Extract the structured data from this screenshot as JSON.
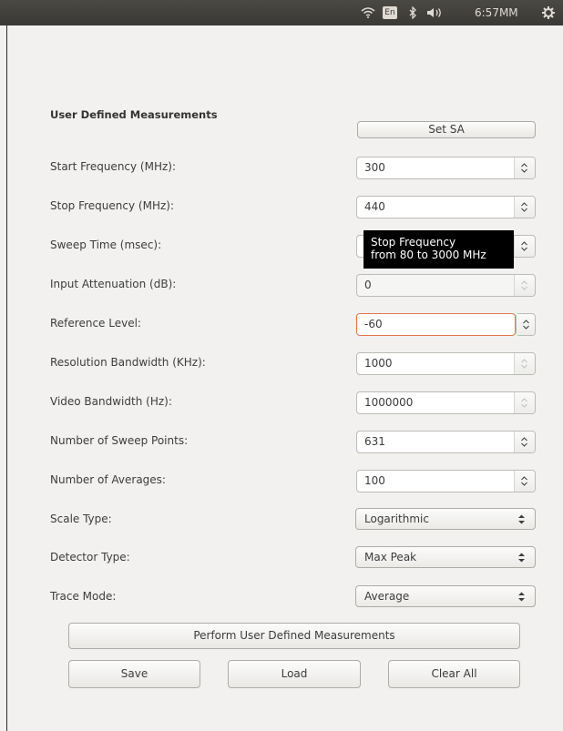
{
  "topbar": {
    "clock": "6:57MM",
    "keyboard_layout": "En"
  },
  "panel": {
    "heading": "User Defined Measurements",
    "set_sa_button": "Set SA",
    "fields": [
      {
        "label": "Start Frequency (MHz):",
        "value": "300"
      },
      {
        "label": "Stop Frequency (MHz):",
        "value": "440"
      },
      {
        "label": "Sweep Time (msec):",
        "value": ""
      },
      {
        "label": "Input Attenuation (dB):",
        "value": "0"
      },
      {
        "label": "Reference Level:",
        "value": "-60"
      },
      {
        "label": "Resolution Bandwidth (KHz):",
        "value": "1000"
      },
      {
        "label": "Video Bandwidth (Hz):",
        "value": "1000000"
      },
      {
        "label": "Number of Sweep Points:",
        "value": "631"
      },
      {
        "label": "Number of Averages:",
        "value": "100"
      }
    ],
    "combos": [
      {
        "label": "Scale Type:",
        "value": "Logarithmic"
      },
      {
        "label": "Detector Type:",
        "value": "Max Peak"
      },
      {
        "label": "Trace Mode:",
        "value": "Average"
      }
    ],
    "tooltip": {
      "line1": "Stop Frequency",
      "line2": "from 80 to 3000 MHz"
    },
    "perform_button": "Perform User Defined Measurements",
    "save_button": "Save",
    "load_button": "Load",
    "clear_button": "Clear All"
  }
}
